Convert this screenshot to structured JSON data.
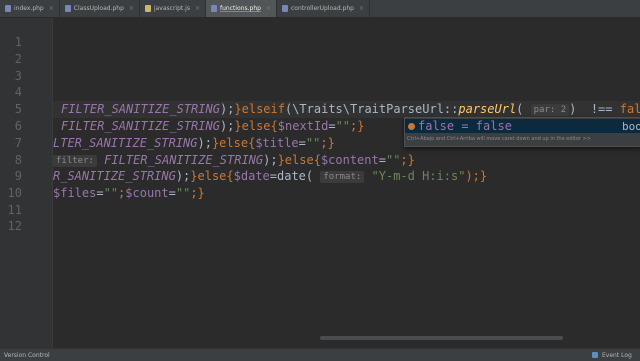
{
  "tabs": [
    {
      "label": "index.php",
      "icon_color": "#7a86b8",
      "active": false
    },
    {
      "label": "ClassUpload.php",
      "icon_color": "#7a86b8",
      "active": false
    },
    {
      "label": "javascript.js",
      "icon_color": "#c9b76a",
      "active": false
    },
    {
      "label": "functions.php",
      "icon_color": "#7a86b8",
      "active": true
    },
    {
      "label": "controllerUpload.php",
      "icon_color": "#7a86b8",
      "active": false
    }
  ],
  "tab_close_glyph": "×",
  "gutter": {
    "line_numbers": [
      "1",
      "2",
      "3",
      "4",
      "5",
      "6",
      "7",
      "8",
      "9",
      "10",
      "11",
      "12"
    ]
  },
  "code": {
    "line6": {
      "t1": "FILTER_SANITIZE_STRING",
      "t2": ");",
      "t3": "}elseif",
      "t4": "(\\Traits\\TraitParseUrl::",
      "t5": "parseUrl",
      "t6": "(",
      "hint": "par: 2",
      "t7": ")  !== ",
      "t8": "false",
      "t9": ")"
    },
    "line7": {
      "t1": "FILTER_SANITIZE_STRING",
      "t2": ");",
      "t3": "}else{",
      "t4": "$nextId",
      "t5": "=",
      "t6": "\"\"",
      "t7": ";}"
    },
    "line8": {
      "t1": "LTER_SANITIZE_STRING",
      "t2": ");",
      "t3": "}else{",
      "t4": "$title",
      "t5": "=",
      "t6": "\"\"",
      "t7": ";}"
    },
    "line9": {
      "hint": "filter:",
      "t1": "FILTER_SANITIZE_STRING",
      "t2": ");",
      "t3": "}else{",
      "t4": "$content",
      "t5": "=",
      "t6": "\"\"",
      "t7": ";}"
    },
    "line10": {
      "t1": "R_SANITIZE_STRING",
      "t2": ");",
      "t3": "}else{",
      "t4": "$date",
      "t5": "=date(",
      "hint": "format:",
      "t6": "\"Y-m-d H:i:s\"",
      "t7": ");}"
    },
    "line11": {
      "t1": "$files",
      "t2": "=",
      "t3": "\"\"",
      "t4": ";",
      "t5": "$count",
      "t6": "=",
      "t7": "\"\"",
      "t8": ";}"
    }
  },
  "completion": {
    "item_name": "false = false",
    "item_type": "boo",
    "tip": "Ctrl+Abajo and Ctrl+Arriba will move caret down and up in the editor  >>"
  },
  "statusbar": {
    "left": "Version Control",
    "right": "Event Log"
  },
  "colors": {
    "background": "#2b2b2b",
    "keyword": "#cc7832",
    "constant": "#9876aa",
    "string": "#6a8759",
    "function": "#ffc66d"
  }
}
